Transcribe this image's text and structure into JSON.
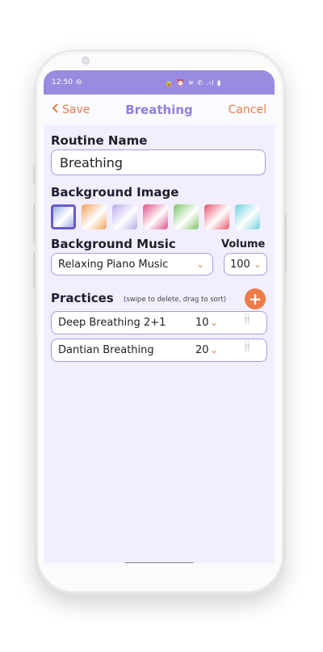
{
  "status_bar": {
    "time": "12:50",
    "clock_icon": "clock-icon",
    "icons": "🔒 ⏰ ≋ ✆ .ıl ▮"
  },
  "header": {
    "save_label": "Save",
    "title": "Breathing",
    "cancel_label": "Cancel"
  },
  "routine": {
    "label": "Routine Name",
    "value": "Breathing"
  },
  "background_image": {
    "label": "Background Image",
    "selected_index": 0,
    "swatches": [
      "#9fb2e8",
      "#f3a05a",
      "#b9a8ea",
      "#e0508a",
      "#7cc46a",
      "#e8566a",
      "#6fcfe0"
    ]
  },
  "music": {
    "label": "Background Music",
    "selected": "Relaxing Piano Music"
  },
  "volume": {
    "label": "Volume",
    "selected": "100"
  },
  "practices": {
    "label": "Practices",
    "hint": "(swipe to delete, drag to sort)",
    "add_label": "+",
    "items": [
      {
        "name": "Deep Breathing 2+1",
        "count": "10"
      },
      {
        "name": "Dantian Breathing",
        "count": "20"
      }
    ]
  },
  "colors": {
    "accent": "#e57e4e",
    "primary": "#8e7fde",
    "status_bar": "#9a8be0",
    "border": "#a59ae8"
  }
}
